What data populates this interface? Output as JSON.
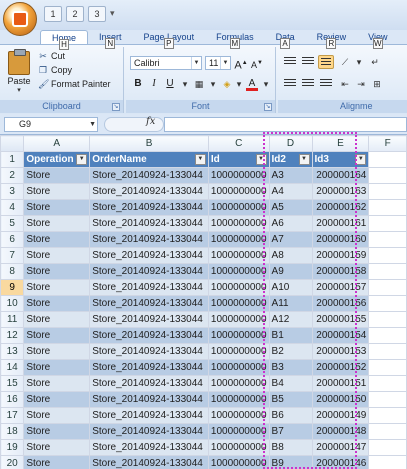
{
  "qat": {
    "save": "1",
    "undo": "2",
    "redo": "3"
  },
  "office_button_keytip": "F",
  "tabs": [
    {
      "label": "Home",
      "keytip": "H",
      "active": true
    },
    {
      "label": "Insert",
      "keytip": "N",
      "active": false
    },
    {
      "label": "Page Layout",
      "keytip": "P",
      "active": false
    },
    {
      "label": "Formulas",
      "keytip": "M",
      "active": false
    },
    {
      "label": "Data",
      "keytip": "A",
      "active": false
    },
    {
      "label": "Review",
      "keytip": "R",
      "active": false
    },
    {
      "label": "View",
      "keytip": "W",
      "active": false
    }
  ],
  "clipboard": {
    "paste_label": "Paste",
    "cut_label": "Cut",
    "copy_label": "Copy",
    "format_painter_label": "Format Painter",
    "group_label": "Clipboard"
  },
  "font": {
    "name": "Calibri",
    "size": "11",
    "bold": "B",
    "italic": "I",
    "underline": "U",
    "grow": "A",
    "shrink": "A",
    "font_color": "A",
    "group_label": "Font"
  },
  "alignment": {
    "group_label": "Alignme"
  },
  "formula_bar": {
    "name_box": "G9",
    "fx": "fx",
    "formula": ""
  },
  "columns": [
    "A",
    "B",
    "C",
    "D",
    "E",
    "F"
  ],
  "table": {
    "headers": [
      "Operation",
      "OrderName",
      "Id",
      "Id2",
      "Id3"
    ],
    "rows": [
      [
        "Store",
        "Store_20140924-133044",
        "1000000000",
        "A3",
        "200000164"
      ],
      [
        "Store",
        "Store_20140924-133044",
        "1000000000",
        "A4",
        "200000163"
      ],
      [
        "Store",
        "Store_20140924-133044",
        "1000000000",
        "A5",
        "200000162"
      ],
      [
        "Store",
        "Store_20140924-133044",
        "1000000000",
        "A6",
        "200000161"
      ],
      [
        "Store",
        "Store_20140924-133044",
        "1000000000",
        "A7",
        "200000160"
      ],
      [
        "Store",
        "Store_20140924-133044",
        "1000000000",
        "A8",
        "200000159"
      ],
      [
        "Store",
        "Store_20140924-133044",
        "1000000000",
        "A9",
        "200000158"
      ],
      [
        "Store",
        "Store_20140924-133044",
        "1000000000",
        "A10",
        "200000157"
      ],
      [
        "Store",
        "Store_20140924-133044",
        "1000000000",
        "A11",
        "200000156"
      ],
      [
        "Store",
        "Store_20140924-133044",
        "1000000000",
        "A12",
        "200000155"
      ],
      [
        "Store",
        "Store_20140924-133044",
        "1000000000",
        "B1",
        "200000154"
      ],
      [
        "Store",
        "Store_20140924-133044",
        "1000000000",
        "B2",
        "200000153"
      ],
      [
        "Store",
        "Store_20140924-133044",
        "1000000000",
        "B3",
        "200000152"
      ],
      [
        "Store",
        "Store_20140924-133044",
        "1000000000",
        "B4",
        "200000151"
      ],
      [
        "Store",
        "Store_20140924-133044",
        "1000000000",
        "B5",
        "200000150"
      ],
      [
        "Store",
        "Store_20140924-133044",
        "1000000000",
        "B6",
        "200000149"
      ],
      [
        "Store",
        "Store_20140924-133044",
        "1000000000",
        "B7",
        "200000148"
      ],
      [
        "Store",
        "Store_20140924-133044",
        "1000000000",
        "B8",
        "200000147"
      ],
      [
        "Store",
        "Store_20140924-133044",
        "1000000000",
        "B9",
        "200000146"
      ]
    ]
  },
  "row_numbers": [
    "1",
    "2",
    "3",
    "4",
    "5",
    "6",
    "7",
    "8",
    "9",
    "10",
    "11",
    "12",
    "13",
    "14",
    "15",
    "16",
    "17",
    "18",
    "19",
    "20"
  ],
  "selected_row": "9",
  "colors": {
    "header_blue": "#4f81bd",
    "band_light": "#dce6f1",
    "band_dark": "#b8cce4",
    "selection_outline": "#cc33cc"
  }
}
